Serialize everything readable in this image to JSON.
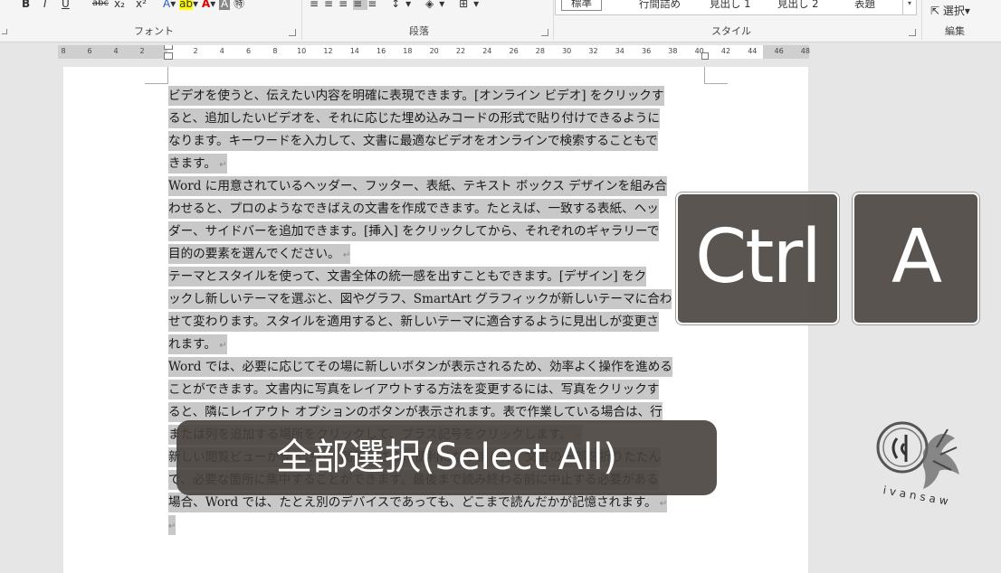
{
  "ribbon": {
    "font_group_label": "フォント",
    "paragraph_group_label": "段落",
    "styles_group_label": "スタイル",
    "editing_group_label": "編集",
    "font_buttons": [
      "B",
      "I",
      "U",
      "abc",
      "x₂",
      "x²"
    ],
    "styles": [
      "標準",
      "行間詰め",
      "見出し 1",
      "見出し 2",
      "表題"
    ],
    "select_button_label": "選択"
  },
  "ruler": {
    "left_numbers": [
      "8",
      "6",
      "4",
      "2"
    ],
    "right_numbers": [
      "2",
      "4",
      "6",
      "8",
      "10",
      "12",
      "14",
      "16",
      "18",
      "20",
      "22",
      "24",
      "26",
      "28",
      "30",
      "32",
      "34",
      "36",
      "38",
      "40",
      "42",
      "44",
      "46",
      "48"
    ]
  },
  "document": {
    "lines": [
      "ビデオを使うと、伝えたい内容を明確に表現できます。[オンライン ビデオ] をクリックす",
      "ると、追加したいビデオを、それに応じた埋め込みコードの形式で貼り付けできるように",
      "なります。キーワードを入力して、文書に最適なビデオをオンラインで検索することもで",
      "きます。",
      "Word に用意されているヘッダー、フッター、表紙、テキスト ボックス デザインを組み合",
      "わせると、プロのようなできばえの文書を作成できます。たとえば、一致する表紙、ヘッ",
      "ダー、サイドバーを追加できます。[挿入] をクリックしてから、それぞれのギャラリーで",
      "目的の要素を選んでください。",
      "テーマとスタイルを使って、文書全体の統一感を出すこともできます。[デザイン] をク",
      "ックし新しいテーマを選ぶと、図やグラフ、SmartArt グラフィックが新しいテーマに合わ",
      "せて変わります。スタイルを適用すると、新しいテーマに適合するように見出しが変更さ",
      "れます。",
      "Word では、必要に応じてその場に新しいボタンが表示されるため、効率よく操作を進める",
      "ことができます。文書内に写真をレイアウトする方法を変更するには、写真をクリックす",
      "ると、隣にレイアウト オプションのボタンが表示されます。表で作業している場合は、行",
      "または列を追加する場所をクリックして、プラス記号をクリックします。",
      "新しい閲覧ビューが導入され、閲覧もさらに便利になりました。文書の一部を折りたたん",
      "で、必要な箇所に集中することができます。最後まで読み終わる前に中止する必要がある",
      "場合、Word では、たとえ別のデバイスであっても、どこまで読んだかが記憶されます。",
      ""
    ],
    "paragraph_mark": "↵"
  },
  "overlay": {
    "key1": "Ctrl",
    "key2": "A",
    "caption": "全部選択(Select All)",
    "watermark_text": "ivansaw"
  }
}
